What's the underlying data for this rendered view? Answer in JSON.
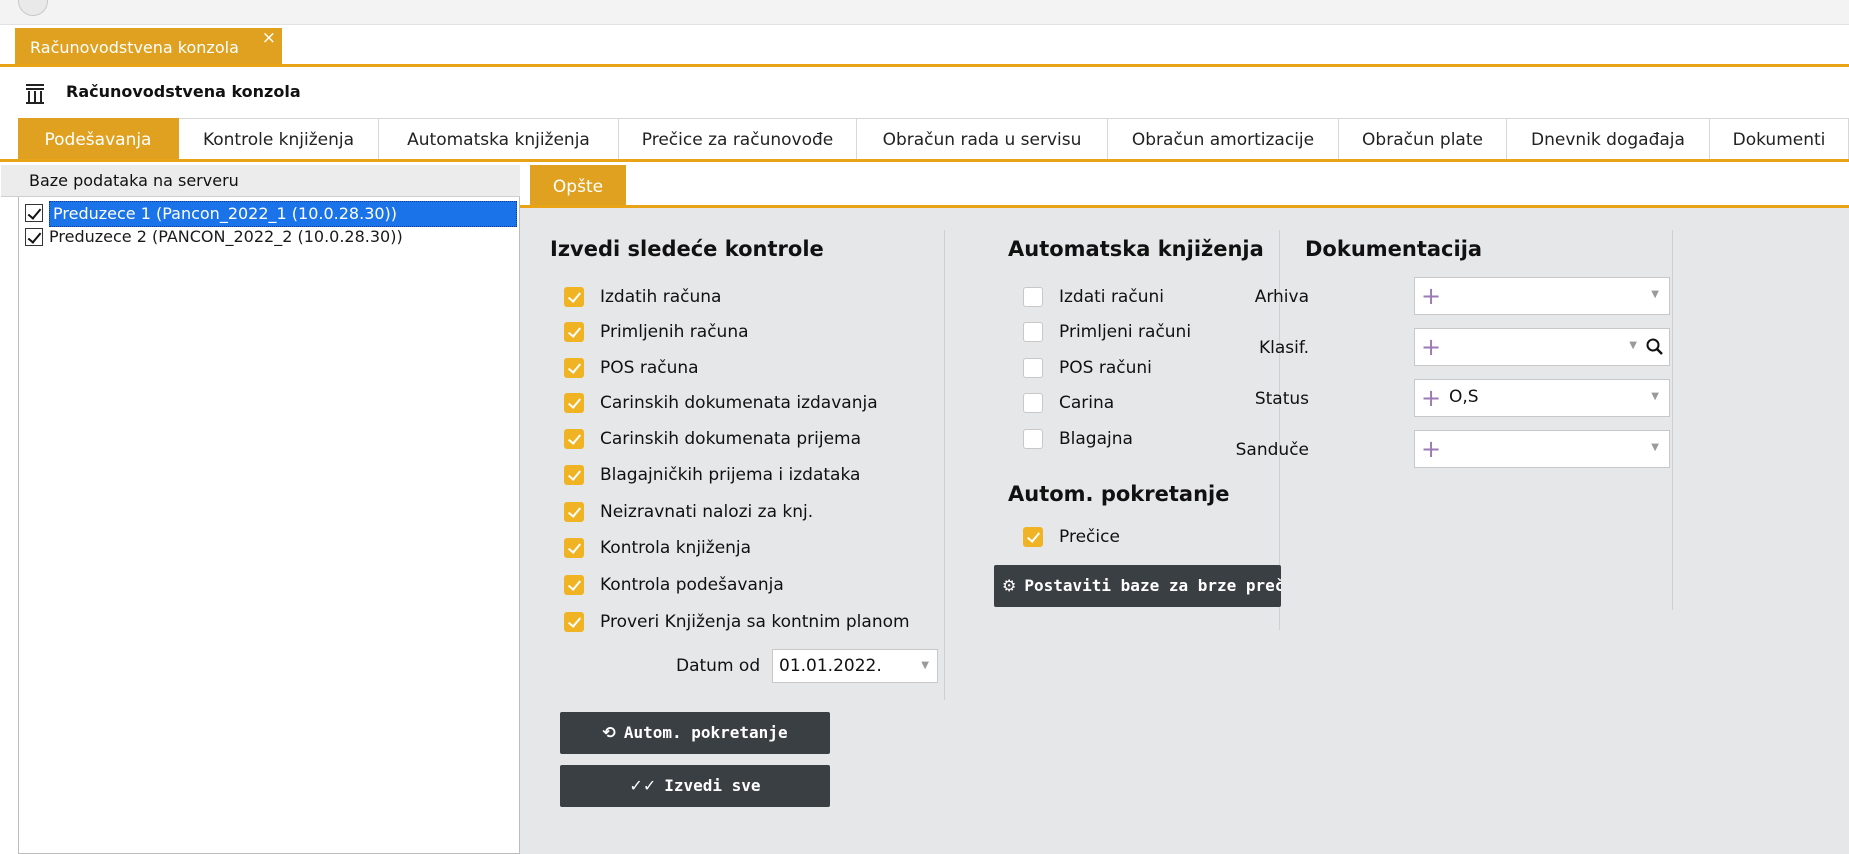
{
  "window": {
    "doc_tab": "Računovodstvena konzola",
    "doc_tab_close": "×",
    "console_title": "Računovodstvena konzola"
  },
  "main_tabs": [
    {
      "label": "Podešavanja",
      "active": true
    },
    {
      "label": "Kontrole knjiženja"
    },
    {
      "label": "Automatska knjiženja"
    },
    {
      "label": "Prečice za računovođe"
    },
    {
      "label": "Obračun rada u servisu"
    },
    {
      "label": "Obračun amortizacije"
    },
    {
      "label": "Obračun plate"
    },
    {
      "label": "Dnevnik događaja"
    },
    {
      "label": "Dokumenti"
    }
  ],
  "left_panel": {
    "header": "Baze podataka na serveru",
    "databases": [
      {
        "label": "Preduzece 1 (Pancon_2022_1 (10.0.28.30))",
        "checked": true,
        "selected": true
      },
      {
        "label": "Preduzece 2 (PANCON_2022_2 (10.0.28.30))",
        "checked": true,
        "selected": false
      }
    ]
  },
  "sub_tabs": [
    {
      "label": "Opšte",
      "active": true
    }
  ],
  "controls": {
    "title": "Izvedi sledeće kontrole",
    "items": [
      {
        "label": "Izdatih računa",
        "checked": true
      },
      {
        "label": "Primljenih računa",
        "checked": true
      },
      {
        "label": "POS računa",
        "checked": true
      },
      {
        "label": "Carinskih dokumenata izdavanja",
        "checked": true
      },
      {
        "label": "Carinskih dokumenata prijema",
        "checked": true
      },
      {
        "label": "Blagajničkih prijema i izdataka",
        "checked": true
      },
      {
        "label": "Neizravnati nalozi za knj.",
        "checked": true
      },
      {
        "label": "Kontrola knjiženja",
        "checked": true
      },
      {
        "label": "Kontrola podešavanja",
        "checked": true
      },
      {
        "label": "Proveri Knjiženja sa kontnim planom",
        "checked": true
      }
    ],
    "datum_label": "Datum od",
    "datum_value": "01.01.2022.",
    "autom_button": "Autom. pokretanje",
    "izvedi_button": "Izvedi sve"
  },
  "auto_booking": {
    "title": "Automatska knjiženja",
    "items": [
      {
        "label": "Izdati računi",
        "checked": false
      },
      {
        "label": "Primljeni računi",
        "checked": false
      },
      {
        "label": "POS računi",
        "checked": false
      },
      {
        "label": "Carina",
        "checked": false
      },
      {
        "label": "Blagajna",
        "checked": false
      }
    ]
  },
  "auto_start": {
    "title": "Autom. pokretanje",
    "items": [
      {
        "label": "Prečice",
        "checked": true
      }
    ],
    "button": "Postaviti baze za brze prečice"
  },
  "documentation": {
    "title": "Dokumentacija",
    "fields": [
      {
        "label": "Arhiva",
        "value": ""
      },
      {
        "label": "Klasif.",
        "value": ""
      },
      {
        "label": "Status",
        "value": "O,S"
      },
      {
        "label": "Sanduče",
        "value": ""
      }
    ]
  },
  "colors": {
    "accent": "#e0a020",
    "checkbox_on": "#f0b323",
    "dark_button": "#3a3f44",
    "selection": "#1a73e8",
    "panel_bg": "#e6e7e9"
  },
  "icons": {
    "console": "columns-icon",
    "autom": "refresh-icon",
    "izvedi": "double-check-icon",
    "postaviti": "gear-icon",
    "klasif_search": "search-icon",
    "doc_plus": "plus-icon"
  }
}
